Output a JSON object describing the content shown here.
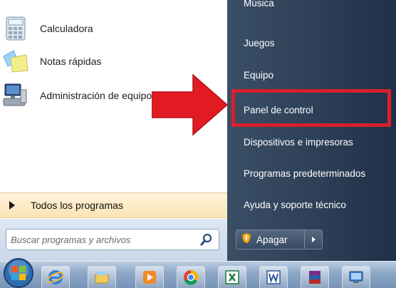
{
  "left_pane": {
    "programs": [
      {
        "label": "Calculadora",
        "icon": "calculator-icon"
      },
      {
        "label": "Notas rápidas",
        "icon": "sticky-notes-icon"
      },
      {
        "label": "Administración de equipo",
        "icon": "computer-management-icon"
      }
    ],
    "all_programs_label": "Todos los programas",
    "search": {
      "placeholder": "Buscar programas y archivos",
      "value": ""
    }
  },
  "right_pane": {
    "items": [
      {
        "label": "Música"
      },
      {
        "label": "Juegos"
      },
      {
        "label": "Equipo"
      },
      {
        "label": "Panel de control",
        "highlighted": true
      },
      {
        "label": "Dispositivos e impresoras"
      },
      {
        "label": "Programas predeterminados"
      },
      {
        "label": "Ayuda y soporte técnico"
      }
    ],
    "shutdown_label": "Apagar"
  },
  "taskbar": {
    "buttons": [
      {
        "icon": "internet-explorer-icon"
      },
      {
        "icon": "file-explorer-icon"
      },
      {
        "icon": "media-player-icon"
      },
      {
        "icon": "chrome-icon"
      },
      {
        "icon": "excel-icon"
      },
      {
        "icon": "word-icon"
      },
      {
        "icon": "winrar-icon"
      },
      {
        "icon": "remote-desktop-icon"
      }
    ]
  },
  "colors": {
    "highlight_border": "#d6202a",
    "arrow": "#e21b23",
    "right_pane_bg": "#2c3f57",
    "all_programs_bg": "#fbe3b3"
  }
}
